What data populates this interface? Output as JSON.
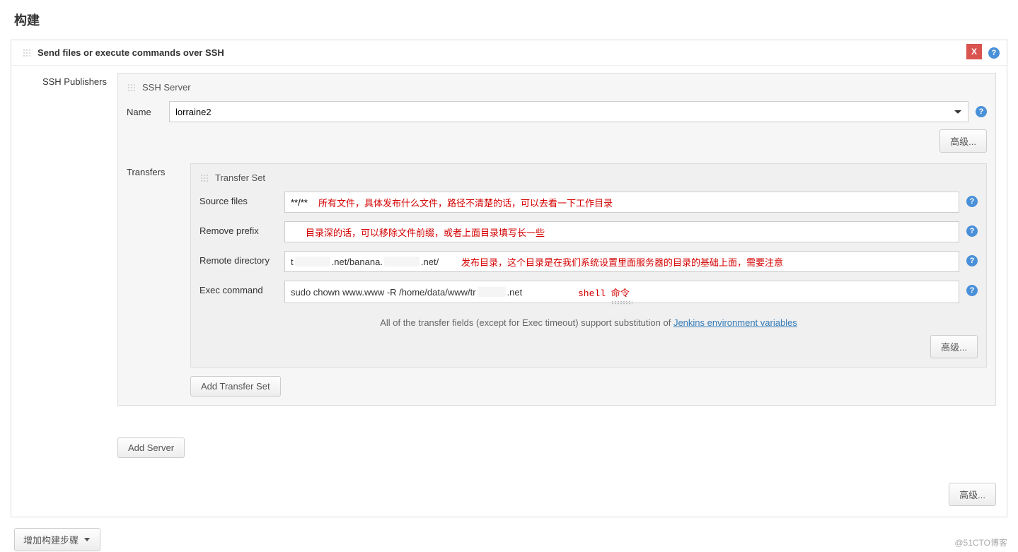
{
  "pageTitle": "构建",
  "section": {
    "title": "Send files or execute commands over SSH",
    "closeLabel": "X"
  },
  "publishers": {
    "label": "SSH Publishers",
    "server": {
      "title": "SSH Server",
      "nameLabel": "Name",
      "nameValue": "lorraine2",
      "advancedLabel": "高级..."
    },
    "transfers": {
      "label": "Transfers",
      "setTitle": "Transfer Set",
      "sourceFiles": {
        "label": "Source files",
        "value": "**/**",
        "note": "所有文件，具体发布什么文件，路径不清楚的话，可以去看一下工作目录"
      },
      "removePrefix": {
        "label": "Remove prefix",
        "value": "",
        "note": "目录深的话，可以移除文件前缀，或者上面目录填写长一些"
      },
      "remoteDirectory": {
        "label": "Remote directory",
        "valuePrefix": "t",
        "valueMid1": ".net/banana.",
        "valueMid2": ".net/",
        "note": "发布目录，这个目录是在我们系统设置里面服务器的目录的基础上面，需要注意"
      },
      "execCommand": {
        "label": "Exec command",
        "valuePrefix": "sudo chown www.www -R /home/data/www/tr",
        "valueSuffix": ".net",
        "note": "shell 命令"
      },
      "footerNote": {
        "pre": "All of the transfer fields (except for Exec timeout) support substitution of ",
        "link": "Jenkins environment variables"
      },
      "advancedLabel": "高级...",
      "addTransferSet": "Add Transfer Set"
    },
    "addServer": "Add Server"
  },
  "outerAdvanced": "高级...",
  "addBuildStep": "增加构建步骤",
  "watermark": "@51CTO博客"
}
